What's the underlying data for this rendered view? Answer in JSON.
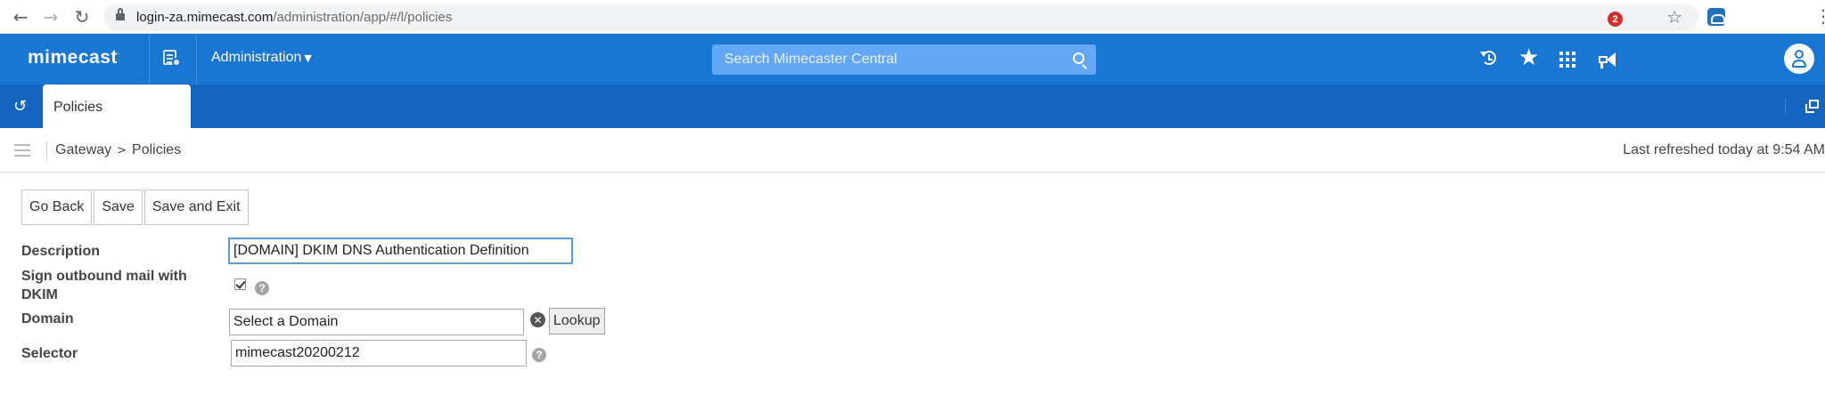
{
  "browser": {
    "url_host": "login-za.mimecast.com",
    "url_path": "/administration/app/#/l/policies"
  },
  "header": {
    "logo": "mimecast",
    "logo_mark": "·",
    "menu_label": "Administration",
    "search_placeholder": "Search Mimecaster Central",
    "notification_count": "2",
    "brand_color": "#1976d2"
  },
  "tabs": {
    "active_label": "Policies"
  },
  "breadcrumb": {
    "items": [
      "Gateway",
      "Policies"
    ],
    "separator": ">",
    "last_refreshed": "Last refreshed today at 9:54 AM"
  },
  "toolbar": {
    "go_back": "Go Back",
    "save": "Save",
    "save_exit": "Save and Exit"
  },
  "form": {
    "description_label": "Description",
    "description_value": "[DOMAIN] DKIM DNS Authentication Definition",
    "sign_label_line1": "Sign outbound mail with",
    "sign_label_line2": "DKIM",
    "sign_checked": true,
    "domain_label": "Domain",
    "domain_value": "Select a Domain",
    "lookup_label": "Lookup",
    "selector_label": "Selector",
    "selector_value": "mimecast20200212",
    "help_glyph": "?",
    "clear_glyph": "✕"
  }
}
